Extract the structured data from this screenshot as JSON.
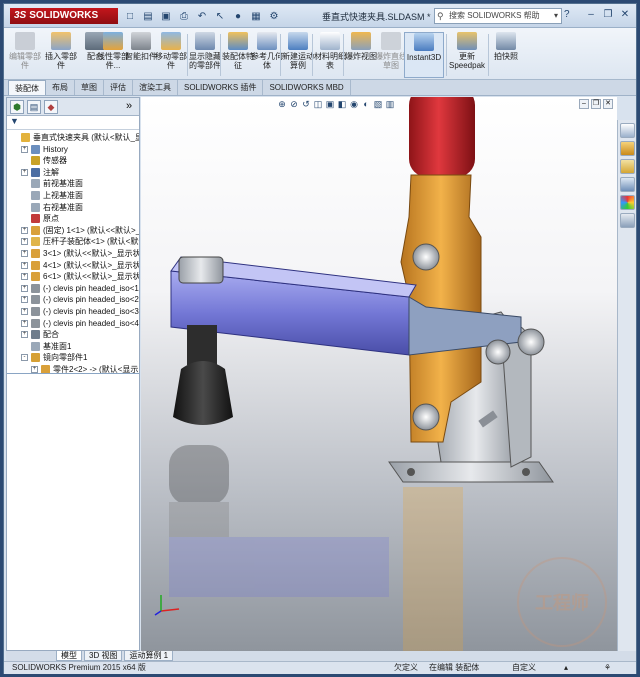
{
  "app": {
    "logo": "SOLIDWORKS",
    "document_title": "垂直式快速夹具.SLDASM *"
  },
  "search": {
    "placeholder": "搜索 SOLIDWORKS 帮助"
  },
  "ribbon": [
    {
      "label": "编辑零部件",
      "disabled": true
    },
    {
      "label": "插入零部件",
      "disabled": false
    },
    {
      "label": "配合",
      "disabled": false
    },
    {
      "label": "线性零部件...",
      "disabled": false
    },
    {
      "label": "智能扣件",
      "disabled": false
    },
    {
      "label": "移动零部件",
      "disabled": false
    },
    {
      "label": "显示隐藏的零部件",
      "disabled": false
    },
    {
      "label": "装配体特征",
      "disabled": false
    },
    {
      "label": "参考几何体",
      "disabled": false
    },
    {
      "label": "新建运动算例",
      "disabled": false
    },
    {
      "label": "材料明细表",
      "disabled": false
    },
    {
      "label": "爆炸视图",
      "disabled": false
    },
    {
      "label": "爆炸直线草图",
      "disabled": true
    },
    {
      "label": "Instant3D",
      "disabled": false,
      "active": true
    },
    {
      "label": "更新Speedpak",
      "disabled": false
    },
    {
      "label": "拍快照",
      "disabled": false
    }
  ],
  "tabs": [
    "装配体",
    "布局",
    "草图",
    "评估",
    "渲染工具",
    "SOLIDWORKS 插件",
    "SOLIDWORKS MBD"
  ],
  "active_tab": "装配体",
  "tree": [
    {
      "label": "垂直式快速夹具 (默认<默认_显示...",
      "level": 0,
      "expand": "",
      "icon": "assembly"
    },
    {
      "label": "History",
      "level": 1,
      "expand": "+",
      "icon": "history"
    },
    {
      "label": "传感器",
      "level": 1,
      "expand": "",
      "icon": "sensor"
    },
    {
      "label": "注解",
      "level": 1,
      "expand": "+",
      "icon": "annotation"
    },
    {
      "label": "前视基准面",
      "level": 1,
      "expand": "",
      "icon": "plane"
    },
    {
      "label": "上视基准面",
      "level": 1,
      "expand": "",
      "icon": "plane"
    },
    {
      "label": "右视基准面",
      "level": 1,
      "expand": "",
      "icon": "plane"
    },
    {
      "label": "原点",
      "level": 1,
      "expand": "",
      "icon": "origin"
    },
    {
      "label": "(固定) 1<1> (默认<<默认>_...",
      "level": 1,
      "expand": "+",
      "icon": "part"
    },
    {
      "label": "压杆子装配体<1> (默认<默认...",
      "level": 1,
      "expand": "+",
      "icon": "subassembly"
    },
    {
      "label": "3<1> (默认<<默认>_显示状...",
      "level": 1,
      "expand": "+",
      "icon": "part"
    },
    {
      "label": "4<1> (默认<<默认>_显示状...",
      "level": 1,
      "expand": "+",
      "icon": "part"
    },
    {
      "label": "6<1> (默认<<默认>_显示状...",
      "level": 1,
      "expand": "+",
      "icon": "part"
    },
    {
      "label": "(-) clevis pin headed_iso<1...",
      "level": 1,
      "expand": "+",
      "icon": "pin"
    },
    {
      "label": "(-) clevis pin headed_iso<2...",
      "level": 1,
      "expand": "+",
      "icon": "pin"
    },
    {
      "label": "(-) clevis pin headed_iso<3...",
      "level": 1,
      "expand": "+",
      "icon": "pin"
    },
    {
      "label": "(-) clevis pin headed_iso<4...",
      "level": 1,
      "expand": "+",
      "icon": "pin"
    },
    {
      "label": "配合",
      "level": 1,
      "expand": "+",
      "icon": "mate"
    },
    {
      "label": "基准面1",
      "level": 1,
      "expand": "",
      "icon": "plane"
    },
    {
      "label": "镜向零部件1",
      "level": 1,
      "expand": "-",
      "icon": "mirror"
    },
    {
      "label": "零件2<2> -> (默认<显示...",
      "level": 2,
      "expand": "+",
      "icon": "part"
    }
  ],
  "model_tabs": [
    "模型",
    "3D 视图",
    "运动算例 1"
  ],
  "active_model_tab": "模型",
  "status": {
    "product": "SOLIDWORKS Premium 2015 x64 版",
    "definition": "欠定义",
    "mode": "在编辑 装配体",
    "units": "自定义"
  },
  "watermark": "工程师",
  "colors": {
    "accent": "#c4161c",
    "arm": "#7b7fd8",
    "link": "#e6a43a",
    "handle": "#c8262c",
    "base": "#cfd2d6"
  }
}
